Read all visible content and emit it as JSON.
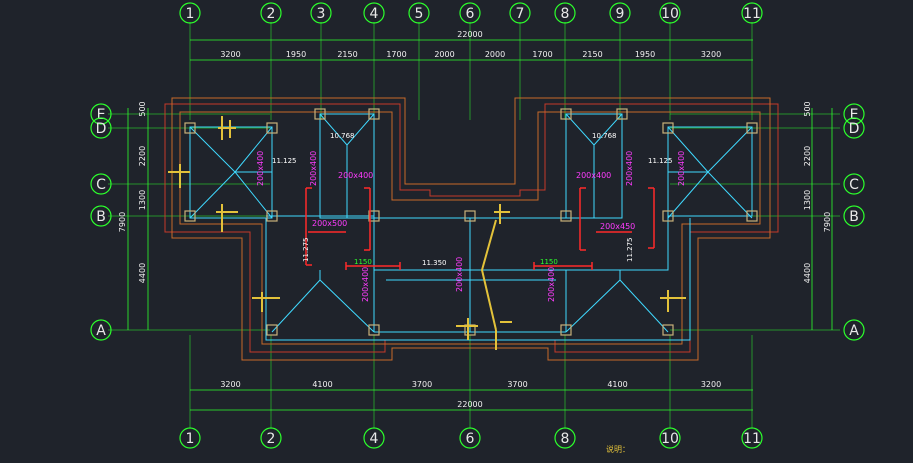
{
  "grid_axes": {
    "top": [
      "1",
      "2",
      "3",
      "4",
      "5",
      "6",
      "7",
      "8",
      "9",
      "10",
      "11"
    ],
    "bottom": [
      "1",
      "2",
      "4",
      "6",
      "8",
      "10",
      "11"
    ],
    "left": [
      "E",
      "D",
      "C",
      "B",
      "A"
    ],
    "right": [
      "E",
      "D",
      "C",
      "B",
      "A"
    ]
  },
  "dimensions": {
    "top_total": "22000",
    "top_segments": [
      "3200",
      "1950",
      "2150",
      "1700",
      "2000",
      "2000",
      "1700",
      "2150",
      "1950",
      "3200"
    ],
    "bottom_total": "22000",
    "bottom_segments": [
      "3200",
      "4100",
      "3700",
      "3700",
      "4100",
      "3200"
    ],
    "left_segments": [
      "500",
      "2200",
      "1300",
      "4400"
    ],
    "left_total": "7900",
    "right_segments": [
      "500",
      "2200",
      "1300",
      "4400"
    ],
    "right_total": "7900"
  },
  "annotations": {
    "elev_1": "10.768",
    "elev_2": "10.768",
    "elev_3": "11.125",
    "elev_4": "11.125",
    "elev_5": "11.275",
    "elev_6": "11.275",
    "elev_7": "11.350",
    "beam_1": "200x400",
    "beam_2": "200x400",
    "beam_3": "200x400",
    "beam_4": "200x400",
    "beam_5": "200x400",
    "beam_6": "200x400",
    "beam_7": "200x500",
    "beam_8": "200x450",
    "beam_9": "200x400",
    "beam_10": "200x400",
    "beam_11": "200x400",
    "dim_1150": "1150",
    "note_title": "说明："
  }
}
